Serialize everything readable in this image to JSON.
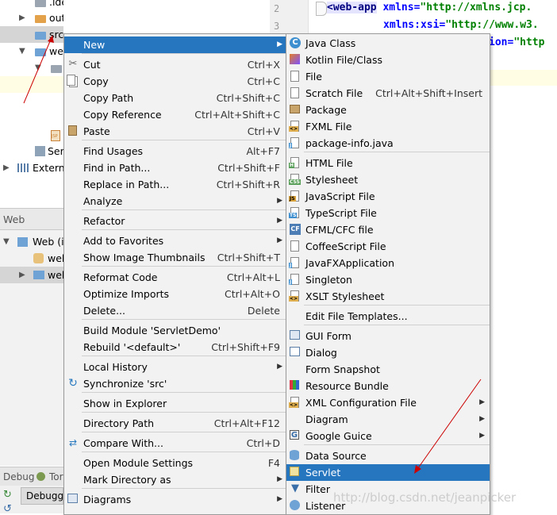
{
  "project_tree": {
    "rows": [
      ".idea",
      "out",
      "src",
      "web",
      "",
      "",
      "",
      "",
      "Ser",
      "Externa"
    ]
  },
  "web_panel": {
    "header": "Web",
    "rows": [
      "Web (i",
      "web",
      "web"
    ]
  },
  "debug_bar": {
    "label": "Debug",
    "tab2": "Tor",
    "tab_debugger": "Debugge"
  },
  "editor": {
    "line_numbers": [
      "2",
      "3"
    ],
    "line1_tag": "<web-app",
    "line1_attr": " xmlns=",
    "line1_str": "\"http://xmlns.jcp.",
    "line2_attr": "xmlns:xsi=",
    "line2_str": "\"http://www.w3.",
    "line3_part": "ion=",
    "line3_str": "\"http"
  },
  "context_menu": {
    "items": [
      {
        "label": "New",
        "shortcut": "",
        "submenu": true,
        "active": true
      },
      {
        "label": "Cut",
        "shortcut": "Ctrl+X",
        "icon": "scissors-icon"
      },
      {
        "label": "Copy",
        "shortcut": "Ctrl+C",
        "icon": "copy-icon"
      },
      {
        "label": "Copy Path",
        "shortcut": "Ctrl+Shift+C"
      },
      {
        "label": "Copy Reference",
        "shortcut": "Ctrl+Alt+Shift+C"
      },
      {
        "label": "Paste",
        "shortcut": "Ctrl+V",
        "icon": "paste-icon"
      },
      {
        "label": "Find Usages",
        "shortcut": "Alt+F7"
      },
      {
        "label": "Find in Path...",
        "shortcut": "Ctrl+Shift+F"
      },
      {
        "label": "Replace in Path...",
        "shortcut": "Ctrl+Shift+R"
      },
      {
        "label": "Analyze",
        "shortcut": "",
        "submenu": true
      },
      {
        "label": "Refactor",
        "shortcut": "",
        "submenu": true
      },
      {
        "label": "Add to Favorites",
        "shortcut": "",
        "submenu": true
      },
      {
        "label": "Show Image Thumbnails",
        "shortcut": "Ctrl+Shift+T"
      },
      {
        "label": "Reformat Code",
        "shortcut": "Ctrl+Alt+L"
      },
      {
        "label": "Optimize Imports",
        "shortcut": "Ctrl+Alt+O"
      },
      {
        "label": "Delete...",
        "shortcut": "Delete"
      },
      {
        "label": "Build Module 'ServletDemo'",
        "shortcut": ""
      },
      {
        "label": "Rebuild '<default>'",
        "shortcut": "Ctrl+Shift+F9"
      },
      {
        "label": "Local History",
        "shortcut": "",
        "submenu": true
      },
      {
        "label": "Synchronize 'src'",
        "shortcut": "",
        "icon": "sync-icon"
      },
      {
        "label": "Show in Explorer",
        "shortcut": ""
      },
      {
        "label": "Directory Path",
        "shortcut": "Ctrl+Alt+F12"
      },
      {
        "label": "Compare With...",
        "shortcut": "Ctrl+D",
        "icon": "compare-icon"
      },
      {
        "label": "Open Module Settings",
        "shortcut": "F4"
      },
      {
        "label": "Mark Directory as",
        "shortcut": "",
        "submenu": true
      },
      {
        "label": "Diagrams",
        "shortcut": "",
        "submenu": true,
        "icon": "diagram-icon"
      }
    ]
  },
  "new_submenu": {
    "items": [
      {
        "label": "Java Class",
        "shortcut": "",
        "icon": "java-class-icon"
      },
      {
        "label": "Kotlin File/Class",
        "shortcut": "",
        "icon": "kotlin-icon"
      },
      {
        "label": "File",
        "shortcut": "",
        "icon": "file-icon"
      },
      {
        "label": "Scratch File",
        "shortcut": "Ctrl+Alt+Shift+Insert",
        "icon": "scratch-file-icon"
      },
      {
        "label": "Package",
        "shortcut": "",
        "icon": "package-icon"
      },
      {
        "label": "FXML File",
        "shortcut": "",
        "icon": "fxml-icon"
      },
      {
        "label": "package-info.java",
        "shortcut": "",
        "icon": "java-file-icon"
      },
      {
        "label": "HTML File",
        "shortcut": "",
        "icon": "html-icon"
      },
      {
        "label": "Stylesheet",
        "shortcut": "",
        "icon": "css-icon"
      },
      {
        "label": "JavaScript File",
        "shortcut": "",
        "icon": "js-icon"
      },
      {
        "label": "TypeScript File",
        "shortcut": "",
        "icon": "ts-icon"
      },
      {
        "label": "CFML/CFC file",
        "shortcut": "",
        "icon": "cfml-icon"
      },
      {
        "label": "CoffeeScript File",
        "shortcut": "",
        "icon": "coffee-icon"
      },
      {
        "label": "JavaFXApplication",
        "shortcut": "",
        "icon": "javafx-icon"
      },
      {
        "label": "Singleton",
        "shortcut": "",
        "icon": "singleton-icon"
      },
      {
        "label": "XSLT Stylesheet",
        "shortcut": "",
        "icon": "xslt-icon"
      },
      {
        "label": "Edit File Templates...",
        "shortcut": ""
      },
      {
        "label": "GUI Form",
        "shortcut": "",
        "icon": "gui-form-icon"
      },
      {
        "label": "Dialog",
        "shortcut": "",
        "icon": "dialog-icon"
      },
      {
        "label": "Form Snapshot",
        "shortcut": ""
      },
      {
        "label": "Resource Bundle",
        "shortcut": "",
        "icon": "resource-bundle-icon"
      },
      {
        "label": "XML Configuration File",
        "shortcut": "",
        "submenu": true,
        "icon": "xml-icon"
      },
      {
        "label": "Diagram",
        "shortcut": "",
        "submenu": true
      },
      {
        "label": "Google Guice",
        "shortcut": "",
        "submenu": true,
        "icon": "guice-icon"
      },
      {
        "label": "Data Source",
        "shortcut": "",
        "icon": "database-icon"
      },
      {
        "label": "Servlet",
        "shortcut": "",
        "active": true,
        "icon": "servlet-icon"
      },
      {
        "label": "Filter",
        "shortcut": "",
        "icon": "filter-icon"
      },
      {
        "label": "Listener",
        "shortcut": "",
        "icon": "listener-icon"
      }
    ]
  },
  "watermark": "http://blog.csdn.net/jeanpicker",
  "colors": {
    "selection": "#2675bf",
    "menu_bg": "#f2f2f2",
    "annotation": "#cc0000"
  }
}
